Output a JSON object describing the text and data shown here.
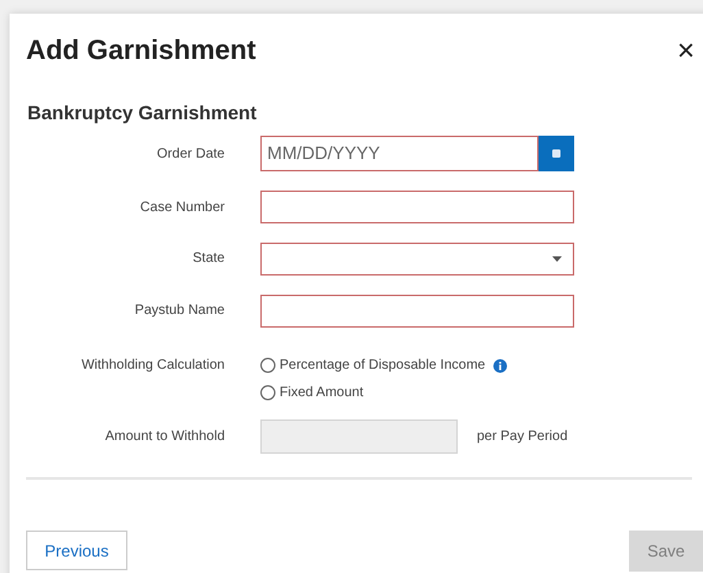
{
  "dialog": {
    "title": "Add Garnishment",
    "close": "×"
  },
  "section_title": "Bankruptcy Garnishment",
  "fields": [
    {
      "kind": "date",
      "label": "Order Date",
      "placeholder": "MM/DD/YYYY",
      "invalid": true
    },
    {
      "kind": "text",
      "label": "Case Number",
      "invalid": true
    },
    {
      "kind": "select",
      "label": "State",
      "invalid": true
    },
    {
      "kind": "text",
      "label": "Paystub Name",
      "invalid": true
    },
    {
      "kind": "radios",
      "label": "Withholding Calculation",
      "options": [
        {
          "label": "Percentage of Disposable Income",
          "selected": false,
          "info": true
        },
        {
          "label": "Fixed Amount",
          "selected": false,
          "info": false
        }
      ]
    },
    {
      "kind": "amount",
      "label": "Amount to Withhold",
      "disabled": true,
      "suffix": "per Pay Period"
    }
  ],
  "buttons": {
    "previous": {
      "label": "Previous",
      "disabled": false
    },
    "save": {
      "label": "Save",
      "disabled": true
    }
  }
}
